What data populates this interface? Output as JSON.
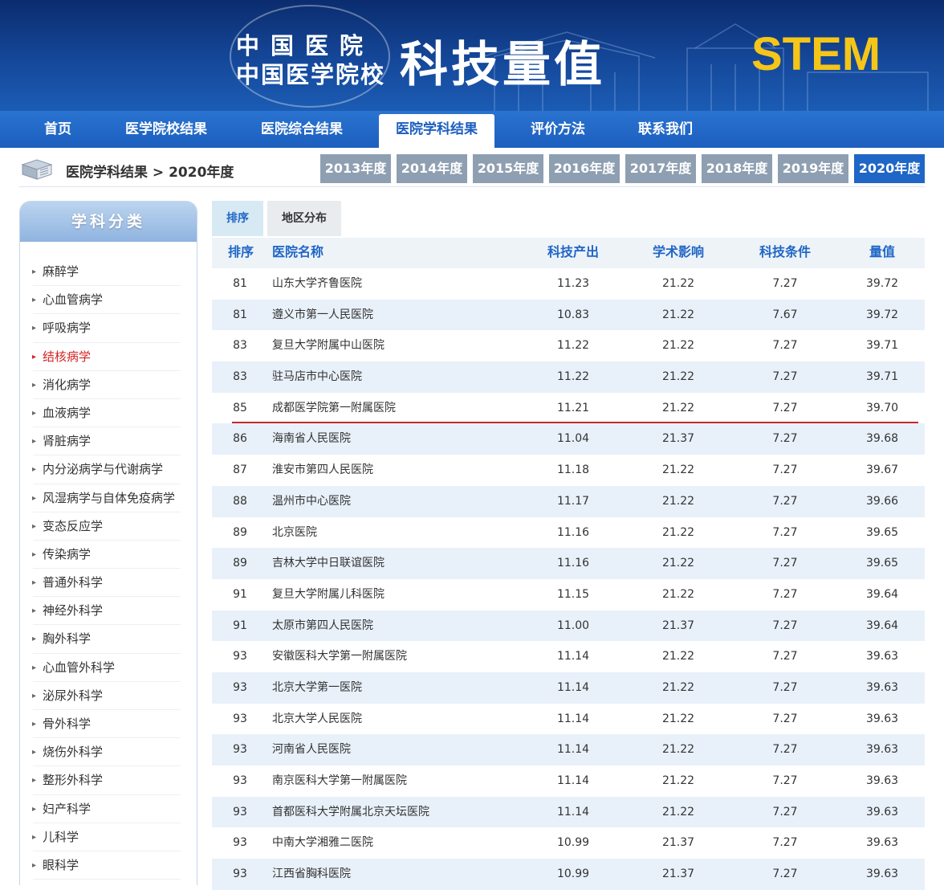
{
  "banner": {
    "org_line1": "中国医院",
    "org_line2": "中国医学院校",
    "title": "科技量值",
    "brand": "STEM"
  },
  "nav": {
    "items": [
      "首页",
      "医学院校结果",
      "医院综合结果",
      "医院学科结果",
      "评价方法",
      "联系我们"
    ],
    "active": "医院学科结果"
  },
  "breadcrumb": "医院学科结果 > 2020年度",
  "years": [
    "2013年度",
    "2014年度",
    "2015年度",
    "2016年度",
    "2017年度",
    "2018年度",
    "2019年度",
    "2020年度"
  ],
  "active_year": "2020年度",
  "sidebar": {
    "title": "学科分类",
    "items": [
      "麻醉学",
      "心血管病学",
      "呼吸病学",
      "结核病学",
      "消化病学",
      "血液病学",
      "肾脏病学",
      "内分泌病学与代谢病学",
      "风湿病学与自体免疫病学",
      "变态反应学",
      "传染病学",
      "普通外科学",
      "神经外科学",
      "胸外科学",
      "心血管外科学",
      "泌尿外科学",
      "骨外科学",
      "烧伤外科学",
      "整形外科学",
      "妇产科学",
      "儿科学",
      "眼科学"
    ],
    "active": "结核病学"
  },
  "tabs": [
    "排序",
    "地区分布"
  ],
  "table": {
    "headers": [
      "排序",
      "医院名称",
      "科技产出",
      "学术影响",
      "科技条件",
      "量值"
    ],
    "rows": [
      [
        "81",
        "山东大学齐鲁医院",
        "11.23",
        "21.22",
        "7.27",
        "39.72"
      ],
      [
        "81",
        "遵义市第一人民医院",
        "10.83",
        "21.22",
        "7.67",
        "39.72"
      ],
      [
        "83",
        "复旦大学附属中山医院",
        "11.22",
        "21.22",
        "7.27",
        "39.71"
      ],
      [
        "83",
        "驻马店市中心医院",
        "11.22",
        "21.22",
        "7.27",
        "39.71"
      ],
      [
        "85",
        "成都医学院第一附属医院",
        "11.21",
        "21.22",
        "7.27",
        "39.70"
      ],
      [
        "86",
        "海南省人民医院",
        "11.04",
        "21.37",
        "7.27",
        "39.68"
      ],
      [
        "87",
        "淮安市第四人民医院",
        "11.18",
        "21.22",
        "7.27",
        "39.67"
      ],
      [
        "88",
        "温州市中心医院",
        "11.17",
        "21.22",
        "7.27",
        "39.66"
      ],
      [
        "89",
        "北京医院",
        "11.16",
        "21.22",
        "7.27",
        "39.65"
      ],
      [
        "89",
        "吉林大学中日联谊医院",
        "11.16",
        "21.22",
        "7.27",
        "39.65"
      ],
      [
        "91",
        "复旦大学附属儿科医院",
        "11.15",
        "21.22",
        "7.27",
        "39.64"
      ],
      [
        "91",
        "太原市第四人民医院",
        "11.00",
        "21.37",
        "7.27",
        "39.64"
      ],
      [
        "93",
        "安徽医科大学第一附属医院",
        "11.14",
        "21.22",
        "7.27",
        "39.63"
      ],
      [
        "93",
        "北京大学第一医院",
        "11.14",
        "21.22",
        "7.27",
        "39.63"
      ],
      [
        "93",
        "北京大学人民医院",
        "11.14",
        "21.22",
        "7.27",
        "39.63"
      ],
      [
        "93",
        "河南省人民医院",
        "11.14",
        "21.22",
        "7.27",
        "39.63"
      ],
      [
        "93",
        "南京医科大学第一附属医院",
        "11.14",
        "21.22",
        "7.27",
        "39.63"
      ],
      [
        "93",
        "首都医科大学附属北京天坛医院",
        "11.14",
        "21.22",
        "7.27",
        "39.63"
      ],
      [
        "93",
        "中南大学湘雅二医院",
        "10.99",
        "21.37",
        "7.27",
        "39.63"
      ],
      [
        "93",
        "江西省胸科医院",
        "10.99",
        "21.37",
        "7.27",
        "39.63"
      ]
    ]
  },
  "colors": {
    "accent": "#1f66c6",
    "brand_yellow": "#f5c518",
    "highlight": "#d42424",
    "separator": "#c62828"
  }
}
